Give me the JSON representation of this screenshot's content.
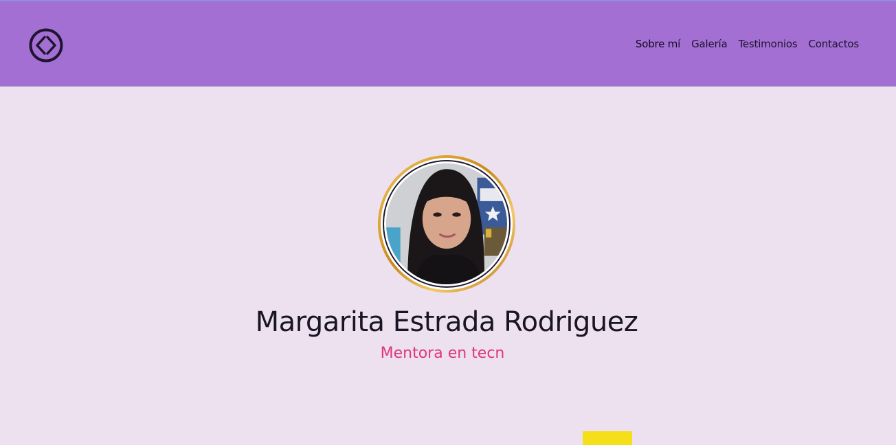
{
  "nav": {
    "items": [
      {
        "label": "Sobre mí",
        "active": true
      },
      {
        "label": "Galería",
        "active": false
      },
      {
        "label": "Testimonios",
        "active": false
      },
      {
        "label": "Contactos",
        "active": false
      }
    ]
  },
  "logo": {
    "icon": "code-brackets-circle-icon"
  },
  "profile": {
    "name": "Margarita Estrada Rodriguez",
    "role": "Mentora en tecn"
  },
  "colors": {
    "header_bg": "#a46fd2",
    "page_bg": "#ede1f0",
    "accent_pink": "#e0357d",
    "accent_yellow": "#f5de1a"
  }
}
